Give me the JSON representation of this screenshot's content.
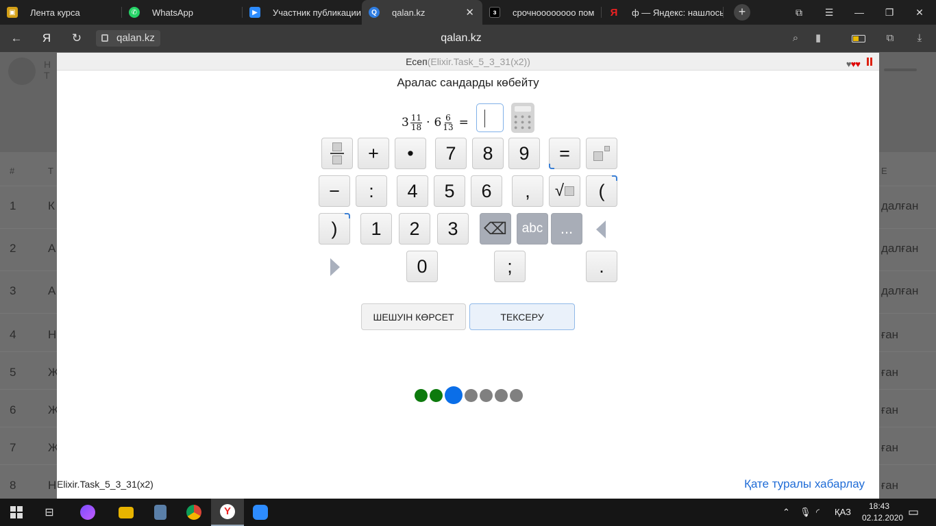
{
  "browser": {
    "tabs": [
      {
        "label": "Лента курса",
        "icon": "course-feed-icon",
        "color": "#d4a017"
      },
      {
        "label": "WhatsApp",
        "icon": "whatsapp-icon",
        "color": "#25d366"
      },
      {
        "label": "Участник публикации",
        "icon": "zoom-icon",
        "color": "#2d8cff"
      },
      {
        "label": "qalan.kz",
        "icon": "qalan-icon",
        "color": "#2f7de1"
      },
      {
        "label": "срочноооооооо пом",
        "icon": "znanija-icon",
        "color": "#000000"
      },
      {
        "label": "ф — Яндекс: нашлось",
        "icon": "yandex-icon",
        "color": "#e22"
      }
    ],
    "yandex_letter": "Я",
    "url": "qalan.kz",
    "page_title": "qalan.kz"
  },
  "background_rows": [
    {
      "num": "1",
      "letter": "К",
      "right": "далған"
    },
    {
      "num": "2",
      "letter": "А",
      "right": "далған"
    },
    {
      "num": "3",
      "letter": "А",
      "right": "далған"
    },
    {
      "num": "4",
      "letter": "Н",
      "right": "ған"
    },
    {
      "num": "5",
      "letter": "Ж",
      "right": "ған"
    },
    {
      "num": "6",
      "letter": "Ж",
      "right": "ған"
    },
    {
      "num": "7",
      "letter": "Ж",
      "right": "ған"
    },
    {
      "num": "8",
      "letter": "Н",
      "right": "ған"
    }
  ],
  "background_header": {
    "hash": "#",
    "col": "Т",
    "right_col": "Е",
    "top_line1": "Н",
    "top_line2": "Т"
  },
  "modal": {
    "header_label": "Есеп",
    "header_task_id": "(Elixir.Task_5_3_31(x2))",
    "hearts": "♥♥♥",
    "task_title": "Аралас сандарды көбейту",
    "expression": {
      "a_whole": "3",
      "a_num": "11",
      "a_den": "18",
      "op": "·",
      "b_whole": "6",
      "b_num": "6",
      "b_den": "13",
      "eq": "="
    },
    "answer_value": "",
    "keypad": {
      "plus": "+",
      "dot_mult": "•",
      "seven": "7",
      "eight": "8",
      "nine": "9",
      "equals": "=",
      "minus": "−",
      "colon": ":",
      "four": "4",
      "five": "5",
      "six": "6",
      "comma": ",",
      "sqrt": "√",
      "lparen": "(",
      "rparen": ")",
      "one": "1",
      "two": "2",
      "three": "3",
      "backspace": "⌫",
      "abc": "abc",
      "more": "...",
      "zero": "0",
      "semicolon": ";",
      "period": "."
    },
    "show_solution_label": "ШЕШУІН КӨРСЕТ",
    "check_label": "ТЕКСЕРУ",
    "progress": {
      "total": 7,
      "done": 2,
      "current_index": 3
    },
    "footer_task_id": "Elixir.Task_5_3_31(x2)",
    "report_link": "Қате туралы хабарлау"
  },
  "taskbar": {
    "language": "ҚАЗ",
    "time": "18:43",
    "date": "02.12.2020"
  }
}
